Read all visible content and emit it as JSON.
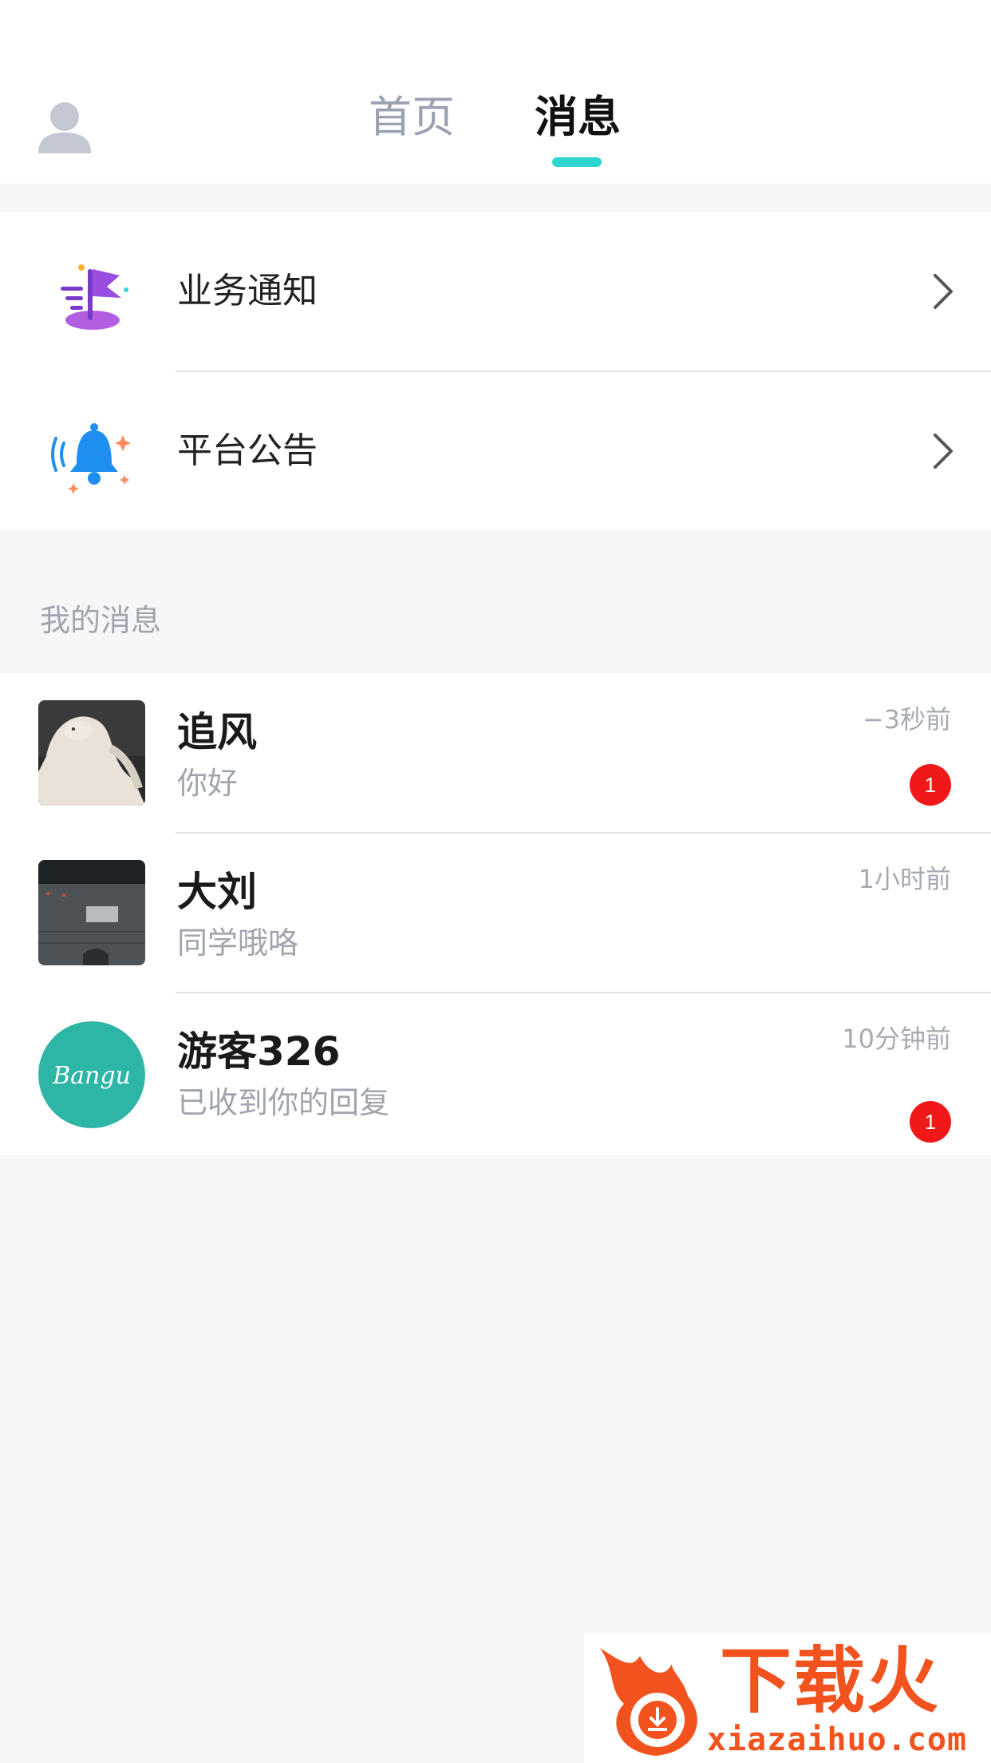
{
  "header": {
    "tabs": [
      {
        "label": "首页",
        "active": false
      },
      {
        "label": "消息",
        "active": true
      }
    ],
    "accent_color": "#2fd6cf"
  },
  "notices": [
    {
      "label": "业务通知",
      "icon": "flag-icon"
    },
    {
      "label": "平台公告",
      "icon": "bell-icon"
    }
  ],
  "section_title": "我的消息",
  "messages": [
    {
      "name": "追风",
      "preview": "你好",
      "time": "−3秒前",
      "badge": "1",
      "avatar": "plush-toy-photo"
    },
    {
      "name": "大刘",
      "preview": "同学哦咯",
      "time": "1小时前",
      "badge": null,
      "avatar": "old-gate-photo"
    },
    {
      "name": "游客326",
      "preview": "已收到你的回复",
      "time": "10分钟前",
      "badge": "1",
      "avatar": "bangu-logo",
      "avatar_text": "Bangu"
    }
  ],
  "watermark": {
    "title": "下载火",
    "url": "xiazaihuo.com"
  },
  "colors": {
    "badge": "#f01818",
    "watermark": "#f2531e"
  }
}
